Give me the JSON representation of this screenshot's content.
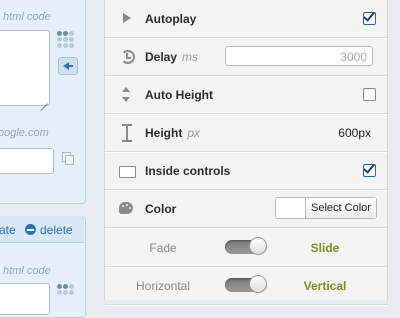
{
  "left_panel": {
    "card1": {
      "html_code_hint": "html code",
      "url_hint": "oogle.com"
    },
    "card2": {
      "action_left": "ate",
      "delete_label": "delete",
      "html_code_hint": "html code"
    }
  },
  "settings": {
    "autoplay": {
      "label": "Autoplay",
      "checked": true,
      "icon": "play-icon"
    },
    "delay": {
      "label": "Delay",
      "unit": "ms",
      "value": "3000",
      "icon": "clock-icon"
    },
    "auto_height": {
      "label": "Auto Height",
      "checked": false,
      "icon": "updown-icon"
    },
    "height": {
      "label": "Height",
      "unit": "px",
      "value": "600px",
      "icon": "vertical-arrow-icon"
    },
    "inside_controls": {
      "label": "Inside controls",
      "checked": true,
      "icon": "rectangle-icon"
    },
    "color": {
      "label": "Color",
      "button_label": "Select Color",
      "swatch": "#ffffff",
      "icon": "palette-icon"
    },
    "effect": {
      "off_label": "Fade",
      "on_label": "Slide"
    },
    "direction": {
      "off_label": "Horizontal",
      "on_label": "Vertical"
    }
  },
  "colors": {
    "panel_bg": "#f4f4f4",
    "left_card_bg": "#e6f0fb",
    "link_blue": "#2a74b4",
    "toggle_active_green": "#7a8e1d"
  }
}
